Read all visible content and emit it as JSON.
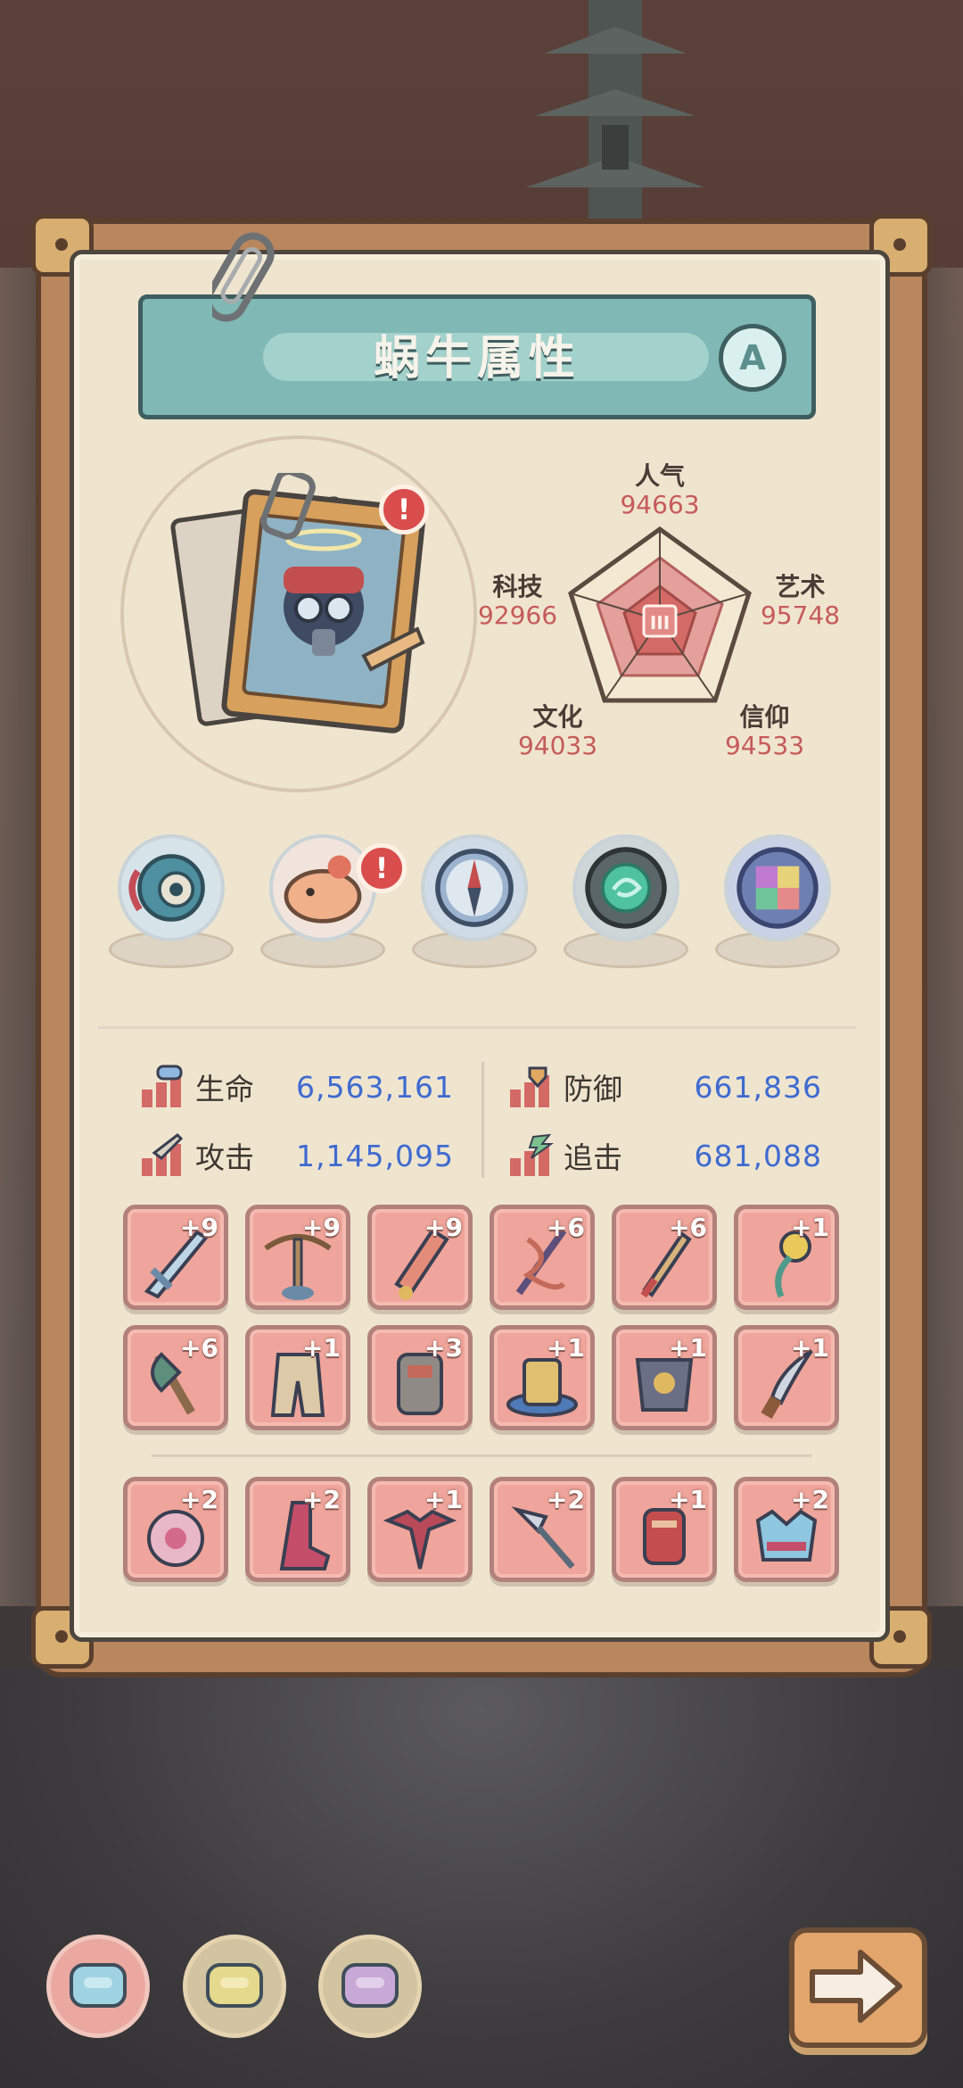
{
  "panel": {
    "title": "蜗牛属性",
    "rank": "A"
  },
  "portrait": {
    "alert": "!"
  },
  "radar": {
    "popularity": {
      "label": "人气",
      "value": "94663"
    },
    "art": {
      "label": "艺术",
      "value": "95748"
    },
    "faith": {
      "label": "信仰",
      "value": "94533"
    },
    "culture": {
      "label": "文化",
      "value": "94033"
    },
    "tech": {
      "label": "科技",
      "value": "92966"
    },
    "rank_numeral": "III"
  },
  "relics": {
    "alert": "!"
  },
  "stats": {
    "hp": {
      "label": "生命",
      "value": "6,563,161"
    },
    "defense": {
      "label": "防御",
      "value": "661,836"
    },
    "attack": {
      "label": "攻击",
      "value": "1,145,095"
    },
    "chase": {
      "label": "追击",
      "value": "681,088"
    }
  },
  "equipment": {
    "row1": [
      "+9",
      "+9",
      "+9",
      "+6",
      "+6",
      "+1"
    ],
    "row2": [
      "+6",
      "+1",
      "+3",
      "+1",
      "+1",
      "+1"
    ],
    "row3": [
      "+2",
      "+2",
      "+1",
      "+2",
      "+1",
      "+2"
    ]
  },
  "colors": {
    "accent_teal": "#7fb8b5",
    "stat_value_blue": "#3f6bd0",
    "radar_value_red": "#c65b5b",
    "slot_pink": "#efa59b"
  }
}
